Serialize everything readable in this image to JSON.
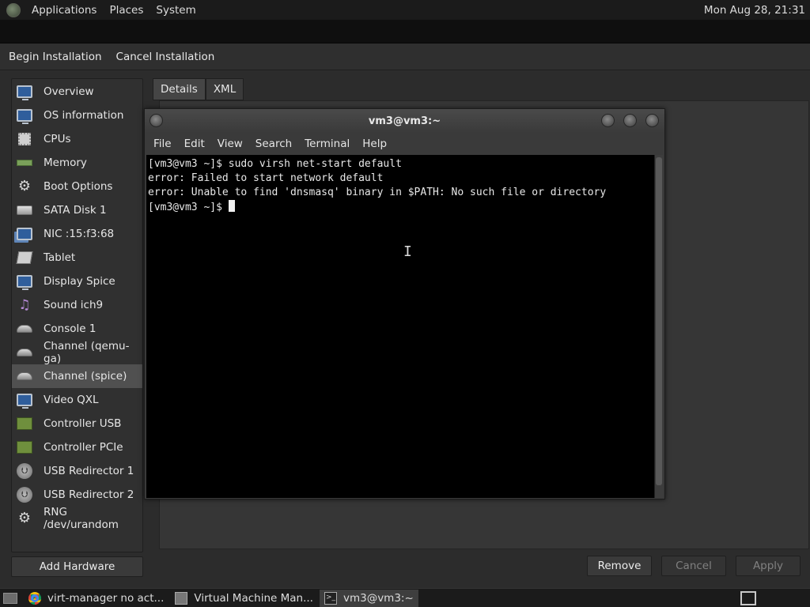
{
  "top_panel": {
    "menus": [
      "Applications",
      "Places",
      "System"
    ],
    "clock": "Mon Aug 28, 21:31"
  },
  "install_bar": {
    "begin": "Begin Installation",
    "cancel": "Cancel Installation"
  },
  "hardware": {
    "items": [
      {
        "label": "Overview",
        "icon": "monitor-icon"
      },
      {
        "label": "OS information",
        "icon": "monitor-icon"
      },
      {
        "label": "CPUs",
        "icon": "cpu-icon"
      },
      {
        "label": "Memory",
        "icon": "memory-icon"
      },
      {
        "label": "Boot Options",
        "icon": "gear-icon"
      },
      {
        "label": "SATA Disk 1",
        "icon": "disk-icon"
      },
      {
        "label": "NIC :15:f3:68",
        "icon": "network-icon"
      },
      {
        "label": "Tablet",
        "icon": "tablet-icon"
      },
      {
        "label": "Display Spice",
        "icon": "monitor-icon"
      },
      {
        "label": "Sound ich9",
        "icon": "sound-icon"
      },
      {
        "label": "Console 1",
        "icon": "channel-icon"
      },
      {
        "label": "Channel (qemu-ga)",
        "icon": "channel-icon"
      },
      {
        "label": "Channel (spice)",
        "icon": "channel-icon"
      },
      {
        "label": "Video QXL",
        "icon": "monitor-icon"
      },
      {
        "label": "Controller USB",
        "icon": "controller-icon"
      },
      {
        "label": "Controller PCIe",
        "icon": "controller-icon"
      },
      {
        "label": "USB Redirector 1",
        "icon": "usb-icon"
      },
      {
        "label": "USB Redirector 2",
        "icon": "usb-icon"
      },
      {
        "label": "RNG /dev/urandom",
        "icon": "gear-icon"
      }
    ],
    "selected": "Channel (spice)",
    "add_button": "Add Hardware"
  },
  "tabs": [
    "Details",
    "XML"
  ],
  "buttons": {
    "remove": "Remove",
    "cancel": "Cancel",
    "apply": "Apply"
  },
  "terminal": {
    "title": "vm3@vm3:~",
    "menu": [
      "File",
      "Edit",
      "View",
      "Search",
      "Terminal",
      "Help"
    ],
    "lines": [
      "[vm3@vm3 ~]$ sudo virsh net-start default",
      "error: Failed to start network default",
      "error: Unable to find 'dnsmasq' binary in $PATH: No such file or directory",
      "",
      "[vm3@vm3 ~]$ "
    ]
  },
  "taskbar": {
    "tasks": [
      {
        "label": "virt-manager no act...",
        "icon": "chrome-icon"
      },
      {
        "label": "Virtual Machine Man...",
        "icon": "vm-manager-icon"
      },
      {
        "label": "vm3@vm3:~",
        "icon": "terminal-icon"
      }
    ]
  }
}
